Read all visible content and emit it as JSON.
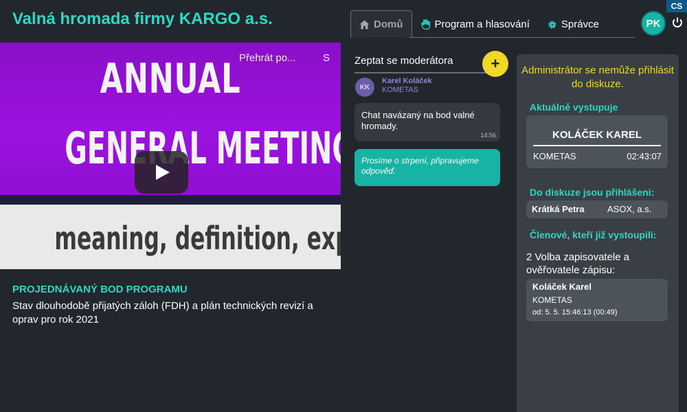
{
  "header": {
    "title": "Valná hromada firmy KARGO a.s.",
    "lang": "CS",
    "avatar_initials": "PK"
  },
  "tabs": [
    {
      "label": "Domů",
      "icon": "home-icon",
      "active": true
    },
    {
      "label": "Program a hlasování",
      "icon": "hand-icon",
      "active": false
    },
    {
      "label": "Správce",
      "icon": "gear-icon",
      "active": false
    }
  ],
  "video": {
    "watch_label": "Přehrát po...",
    "share_label": "S",
    "thumb_line1": "ANNUAL",
    "thumb_line2": "GENERAL MEETING",
    "thumb_line3": "meaning, definition, explanation..."
  },
  "agenda": {
    "heading": "PROJEDNÁVANÝ BOD PROGRAMU",
    "text": "Stav dlouhodobě přijatých záloh (FDH) a plán technických revizí a oprav pro rok 2021"
  },
  "chat": {
    "title": "Zeptat se moderátora",
    "add_symbol": "+",
    "author_initials": "KK",
    "author_name": "Karel Koláček",
    "author_org": "KOMETAS",
    "message": "Chat navázaný na bod valné hromady.",
    "message_time": "14:56",
    "reply": "Prosíme o strpení, připravujeme odpověď."
  },
  "admin": {
    "warning": "Administrátor se nemůže přihlásit do diskuze.",
    "current_title": "Aktuálně vystupuje",
    "current_name": "KOLÁČEK KAREL",
    "current_org": "KOMETAS",
    "current_time": "02:43:07",
    "registered_title": "Do diskuze jsou přihlášeni:",
    "registered_name": "Krátká Petra",
    "registered_org": "ASOX, a.s.",
    "past_title": "Členové, kteří již vystoupili:",
    "past_item_label": "2 Volba zapisovatele a ověřovatele zápisu:",
    "past_name": "Koláček Karel",
    "past_org": "KOMETAS",
    "past_time": "od: 5. 5. 15:46:13 (00:49)"
  },
  "colors": {
    "accent": "#2ed8c4",
    "warning": "#f1d72a",
    "reply_bubble": "#17b4a6",
    "background": "#22262d"
  }
}
